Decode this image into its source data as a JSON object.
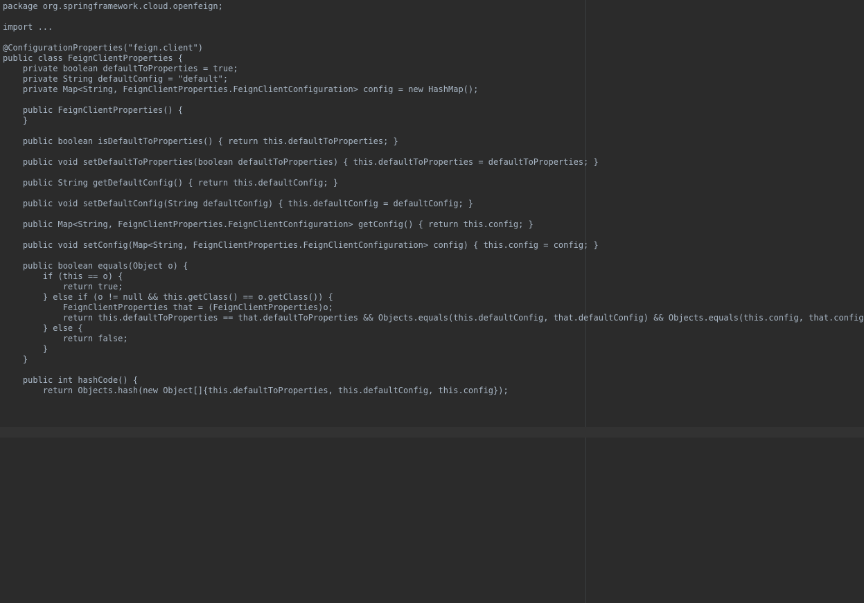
{
  "editor": {
    "language": "java",
    "lines": [
      {
        "text": "package org.springframework.cloud.openfeign;"
      },
      {
        "text": "import ..."
      },
      {
        "text": "@ConfigurationProperties(\"feign.client\")"
      },
      {
        "text": "public class FeignClientProperties {"
      },
      {
        "text": "    private boolean defaultToProperties = true;"
      },
      {
        "text": "    private String defaultConfig = \"default\";"
      },
      {
        "text": "    private Map<String, FeignClientProperties.FeignClientConfiguration> config = new HashMap();"
      },
      {
        "text": "    public FeignClientProperties() {"
      },
      {
        "text": "    }"
      },
      {
        "text": "    public boolean isDefaultToProperties() { return this.defaultToProperties; }"
      },
      {
        "text": "    public void setDefaultToProperties(boolean defaultToProperties) { this.defaultToProperties = defaultToProperties; }"
      },
      {
        "text": "    public String getDefaultConfig() { return this.defaultConfig; }"
      },
      {
        "text": "    public void setDefaultConfig(String defaultConfig) { this.defaultConfig = defaultConfig; }"
      },
      {
        "text": "    public Map<String, FeignClientProperties.FeignClientConfiguration> getConfig() { return this.config; }"
      },
      {
        "text": "    public void setConfig(Map<String, FeignClientProperties.FeignClientConfiguration> config) { this.config = config; }"
      },
      {
        "text": "    public boolean equals(Object o) {"
      },
      {
        "text": "        if (this == o) {"
      },
      {
        "text": "            return true;"
      },
      {
        "text": "        } else if (o != null && this.getClass() == o.getClass()) {"
      },
      {
        "text": "            FeignClientProperties that = (FeignClientProperties)o;"
      },
      {
        "text": "            return this.defaultToProperties == that.defaultToProperties && Objects.equals(this.defaultConfig, that.defaultConfig) && Objects.equals(this.config, that.config);"
      },
      {
        "text": "        } else {"
      },
      {
        "text": "            return false;"
      },
      {
        "text": "        }"
      },
      {
        "text": "    }"
      },
      {
        "text": "    public int hashCode() {"
      },
      {
        "text": "        return Objects.hash(new Object[]{this.defaultToProperties, this.defaultConfig, this.config});"
      }
    ]
  }
}
